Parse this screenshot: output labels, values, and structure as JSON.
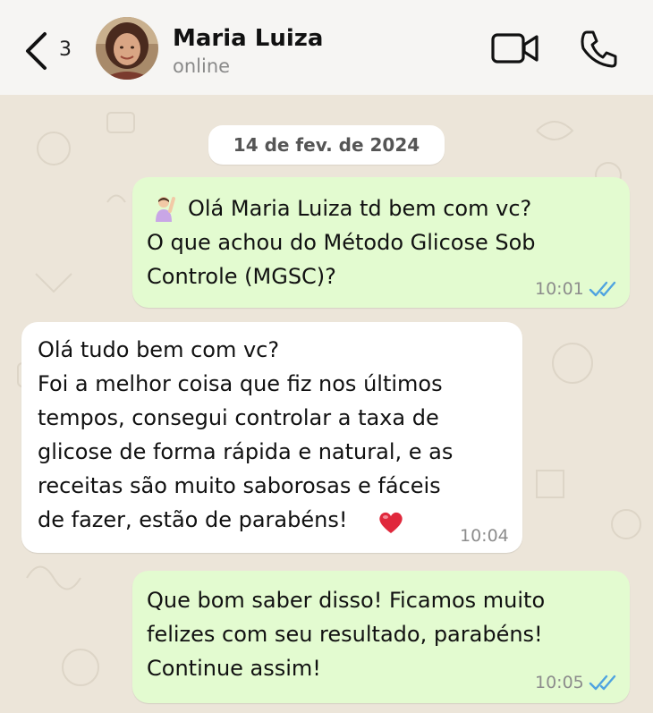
{
  "header": {
    "back_count": "3",
    "contact_name": "Maria Luiza",
    "status": "online"
  },
  "chat": {
    "date_chip": "14 de fev. de 2024",
    "messages": [
      {
        "direction": "outgoing",
        "emoji": "raising-hand-woman",
        "lines": [
          "Olá Maria Luiza td bem com vc?",
          "O que achou do Método Glicose Sob",
          "Controle (MGSC)?"
        ],
        "time": "10:01",
        "status": "read"
      },
      {
        "direction": "incoming",
        "lines": [
          "Olá tudo bem com vc?",
          "Foi a melhor coisa que fiz nos últimos",
          "tempos, consegui controlar a taxa de",
          "glicose de forma rápida e natural, e as",
          "receitas são muito saborosas e fáceis",
          "de fazer, estão de parabéns!"
        ],
        "emoji_end": "heart",
        "time": "10:04"
      },
      {
        "direction": "outgoing",
        "lines": [
          "Que bom saber disso! Ficamos muito",
          "felizes com seu resultado, parabéns!",
          "Continue assim!"
        ],
        "time": "10:05",
        "status": "read"
      }
    ]
  },
  "colors": {
    "outgoing_bubble": "#e3fbd0",
    "incoming_bubble": "#ffffff",
    "read_ticks": "#4fa3e0",
    "chat_background": "#ece5d9"
  }
}
